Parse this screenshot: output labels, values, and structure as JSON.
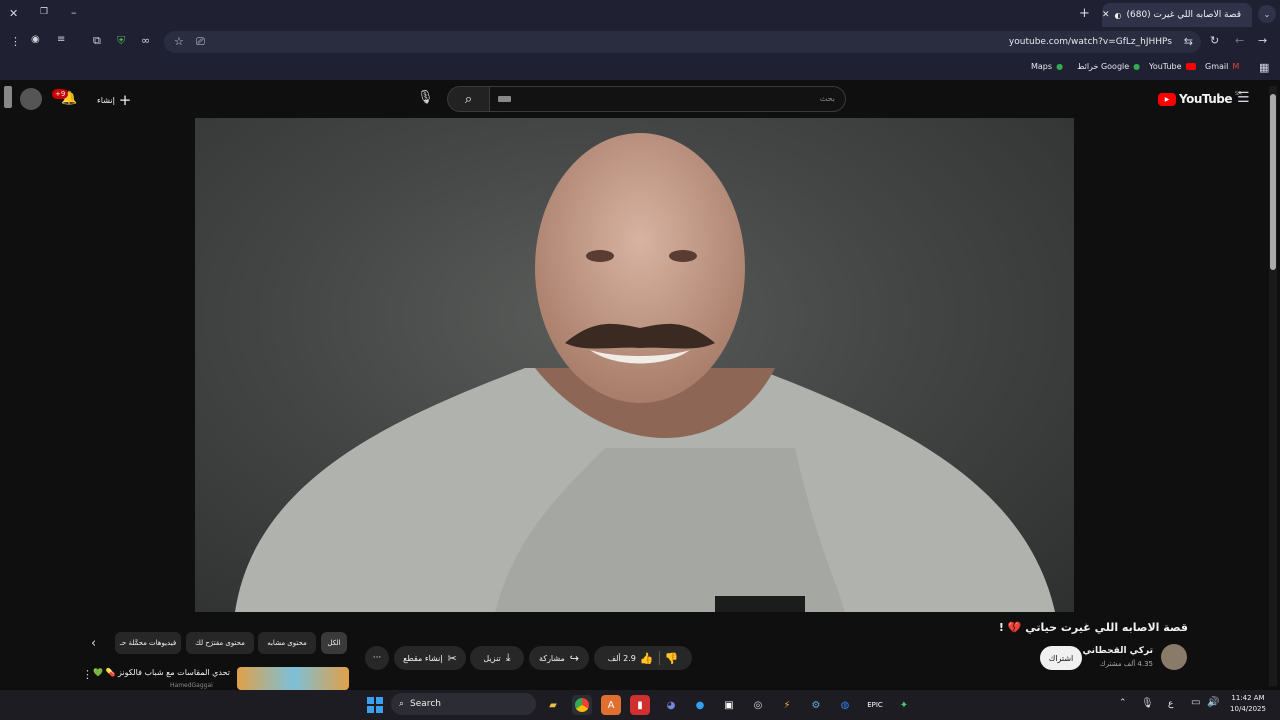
{
  "browser": {
    "tab_title": "(680) قصة الاصابه اللي غيرت",
    "url": "youtube.com/watch?v=GfLz_hJHHPs",
    "bookmarks": [
      "Gmail",
      "YouTube",
      "خرائط Google",
      "Maps"
    ]
  },
  "youtube": {
    "logo_text": "YouTube",
    "region": "SA",
    "search_placeholder": "بحث",
    "create_label": "إنشاء",
    "notifications_badge": "+9"
  },
  "video": {
    "title": "قصة الاصابه اللي غيرت حياتي 💔 !",
    "channel_name": "تركي القحطاني",
    "subscribers": "4.35 ألف مشترك",
    "subscribe_label": "اشتراك",
    "likes": "2.9 ألف",
    "share_label": "مشاركة",
    "download_label": "تنزيل",
    "clip_label": "إنشاء مقطع",
    "more_label": "···"
  },
  "filter_chips": [
    "الكل",
    "محتوى مشابه",
    "محتوى مقترَح لك",
    "فيديوهات محمَّلة حـ"
  ],
  "recommendation": {
    "title": "تحدي المقاسات مع شباب فالكونز 💊 💚",
    "channel": "HamedGaggai"
  },
  "taskbar": {
    "search_label": "Search",
    "time": "11:42 AM",
    "date": "10/4/2025",
    "lang": "ع"
  },
  "colors": {
    "youtube_red": "#ff0000",
    "chrome_frame": "#1f2133",
    "page_bg": "#0f0f0f"
  }
}
